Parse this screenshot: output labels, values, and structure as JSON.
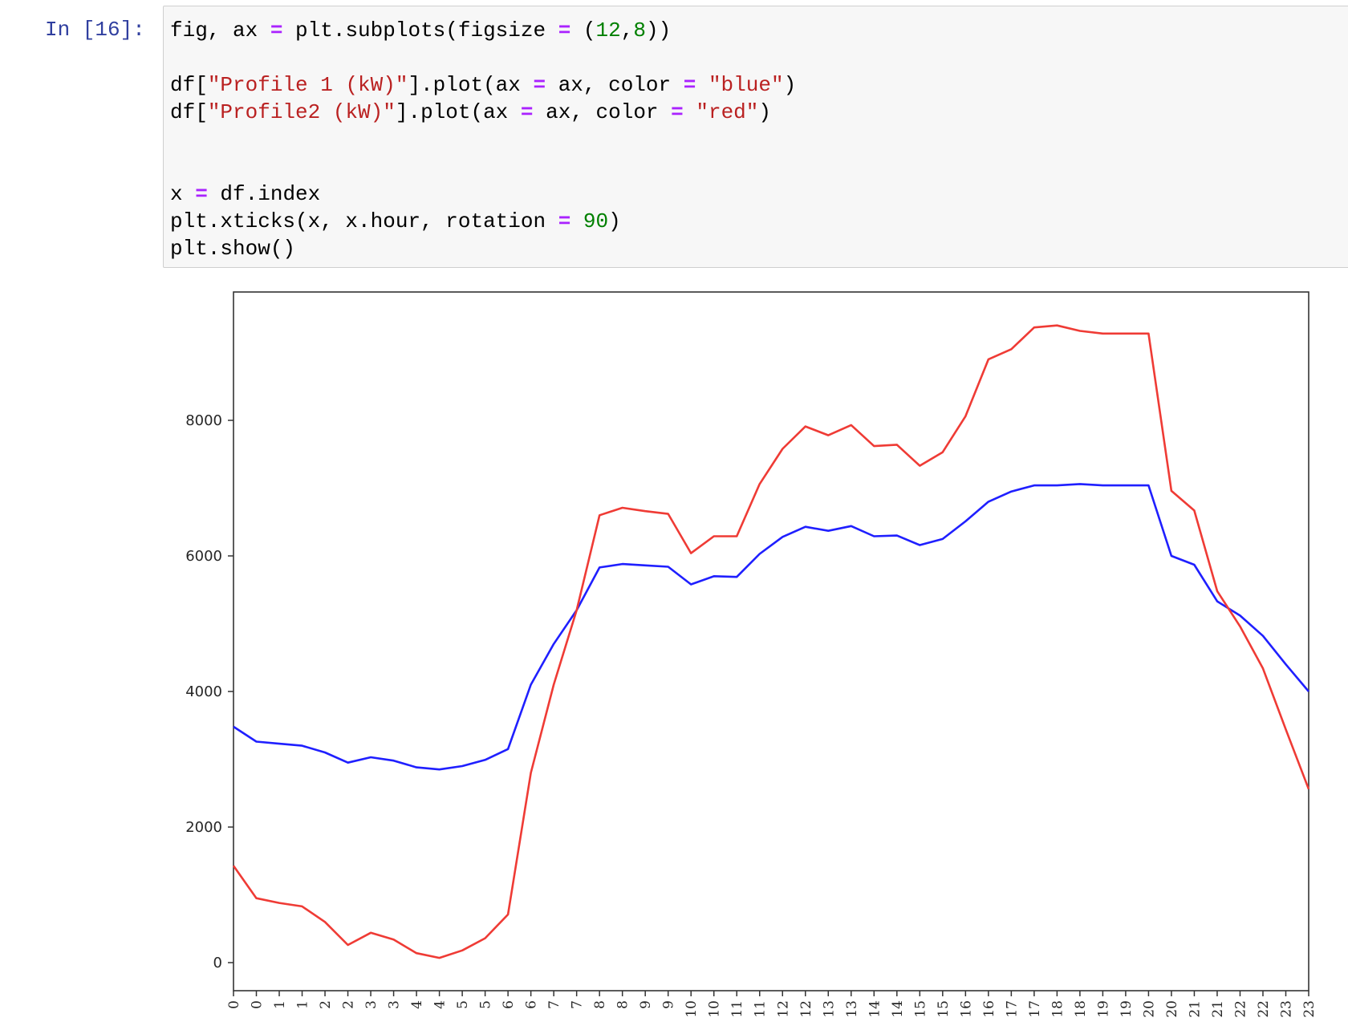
{
  "cell": {
    "prompt": "In [16]:",
    "code_lines": [
      [
        {
          "t": "fig, ax ",
          "c": ""
        },
        {
          "t": "=",
          "c": "op"
        },
        {
          "t": " plt.subplots(figsize ",
          "c": ""
        },
        {
          "t": "=",
          "c": "op"
        },
        {
          "t": " (",
          "c": ""
        },
        {
          "t": "12",
          "c": "num"
        },
        {
          "t": ",",
          "c": ""
        },
        {
          "t": "8",
          "c": "num"
        },
        {
          "t": "))",
          "c": ""
        }
      ],
      [],
      [
        {
          "t": "df[",
          "c": ""
        },
        {
          "t": "\"Profile 1 (kW)\"",
          "c": "str"
        },
        {
          "t": "].plot(ax ",
          "c": ""
        },
        {
          "t": "=",
          "c": "op"
        },
        {
          "t": " ax, color ",
          "c": ""
        },
        {
          "t": "=",
          "c": "op"
        },
        {
          "t": " ",
          "c": ""
        },
        {
          "t": "\"blue\"",
          "c": "str"
        },
        {
          "t": ")",
          "c": ""
        }
      ],
      [
        {
          "t": "df[",
          "c": ""
        },
        {
          "t": "\"Profile2 (kW)\"",
          "c": "str"
        },
        {
          "t": "].plot(ax ",
          "c": ""
        },
        {
          "t": "=",
          "c": "op"
        },
        {
          "t": " ax, color ",
          "c": ""
        },
        {
          "t": "=",
          "c": "op"
        },
        {
          "t": " ",
          "c": ""
        },
        {
          "t": "\"red\"",
          "c": "str"
        },
        {
          "t": ")",
          "c": ""
        }
      ],
      [],
      [],
      [
        {
          "t": "x ",
          "c": ""
        },
        {
          "t": "=",
          "c": "op"
        },
        {
          "t": " df.index",
          "c": ""
        }
      ],
      [
        {
          "t": "plt.xticks(x, x.hour, rotation ",
          "c": ""
        },
        {
          "t": "=",
          "c": "op"
        },
        {
          "t": " ",
          "c": ""
        },
        {
          "t": "90",
          "c": "num"
        },
        {
          "t": ")",
          "c": ""
        }
      ],
      [
        {
          "t": "plt.show()",
          "c": ""
        }
      ]
    ]
  },
  "chart_data": {
    "type": "line",
    "title": "",
    "xlabel": "",
    "ylabel": "",
    "x_tick_labels": [
      "0",
      "0",
      "1",
      "1",
      "2",
      "2",
      "3",
      "3",
      "4",
      "4",
      "5",
      "5",
      "6",
      "6",
      "7",
      "7",
      "8",
      "8",
      "9",
      "9",
      "10",
      "10",
      "11",
      "11",
      "12",
      "12",
      "13",
      "13",
      "14",
      "14",
      "15",
      "15",
      "16",
      "16",
      "17",
      "17",
      "18",
      "18",
      "19",
      "19",
      "20",
      "20",
      "21",
      "21",
      "22",
      "22",
      "23",
      "23"
    ],
    "y_ticks": [
      0,
      2000,
      4000,
      6000,
      8000
    ],
    "y_tick_labels": [
      "0",
      "2000",
      "4000",
      "6000",
      "8000"
    ],
    "ylim": [
      -420,
      9850
    ],
    "grid": false,
    "legend": "none",
    "series": [
      {
        "name": "Profile 1 (kW)",
        "color": "#0000ff",
        "values": [
          3480,
          3260,
          3230,
          3200,
          3100,
          2950,
          3030,
          2980,
          2880,
          2850,
          2900,
          2990,
          3150,
          4100,
          4700,
          5200,
          5830,
          5880,
          5860,
          5840,
          5580,
          5700,
          5690,
          6030,
          6280,
          6430,
          6370,
          6440,
          6290,
          6300,
          6160,
          6250,
          6510,
          6800,
          6950,
          7040,
          7040,
          7060,
          7040,
          7040,
          7040,
          6000,
          5870,
          5330,
          5120,
          4820,
          4400,
          4000
        ]
      },
      {
        "name": "Profile2 (kW)",
        "color": "#ff0000",
        "values": [
          1430,
          950,
          880,
          830,
          600,
          260,
          440,
          340,
          140,
          70,
          180,
          360,
          710,
          2800,
          4100,
          5200,
          6600,
          6710,
          6660,
          6620,
          6040,
          6290,
          6290,
          7060,
          7580,
          7910,
          7780,
          7930,
          7620,
          7640,
          7330,
          7530,
          8060,
          8900,
          9050,
          9370,
          9400,
          9320,
          9280,
          9280,
          9280,
          6960,
          6670,
          5480,
          4960,
          4340,
          3440,
          2560
        ]
      }
    ]
  }
}
